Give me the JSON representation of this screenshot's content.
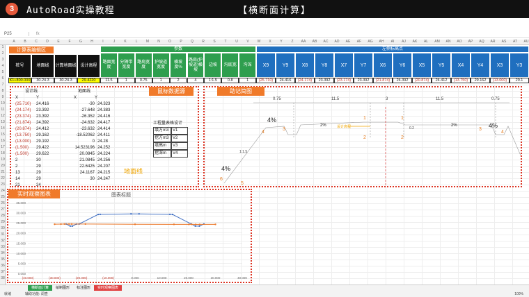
{
  "banner": {
    "number": "3",
    "title": "AutoRoad实操教程",
    "section": "【横断面计算】"
  },
  "formula_bar": {
    "cell_ref": "P25",
    "fx": "fx"
  },
  "column_letters": [
    "A",
    "B",
    "C",
    "D",
    "E",
    "F",
    "G",
    "H",
    "I",
    "J",
    "K",
    "L",
    "M",
    "N",
    "O",
    "P",
    "Q",
    "R",
    "S",
    "T",
    "U",
    "V",
    "W",
    "X",
    "Y",
    "Z",
    "AA",
    "AB",
    "AC",
    "AD",
    "AE",
    "AF",
    "AG",
    "AH",
    "AI",
    "AJ",
    "AK",
    "AL",
    "AM",
    "AN",
    "AO",
    "AP",
    "AQ",
    "AR",
    "AS",
    "AT",
    "AU"
  ],
  "row_numbers": [
    "1",
    "2",
    "3",
    "4",
    "5",
    "6",
    "7",
    "8",
    "9",
    "10",
    "11",
    "12",
    "13",
    "14",
    "15",
    "16",
    "17",
    "18",
    "19",
    "20",
    "21",
    "22",
    "23",
    "24",
    "25",
    "26",
    "27",
    "28",
    "29",
    "30",
    "31",
    "32",
    "33",
    "34",
    "35",
    "36",
    "37",
    "38"
  ],
  "header": {
    "calc_area": "计算表编辑区",
    "params": "参数",
    "left_points": "左侧标高点",
    "cols_dark": [
      "桩号",
      "地面线",
      "计算地面线",
      "设计高程"
    ],
    "cols_green": [
      "路面宽度",
      "分隔带宽度",
      "路肩宽度",
      "护坡道宽度",
      "横坡度%",
      "路肩(护坡道)横坡",
      "边坡",
      "沟底宽",
      "沟深"
    ],
    "cols_blue": [
      "X9",
      "Y9",
      "X8",
      "Y8",
      "X7",
      "Y7",
      "X6",
      "Y6",
      "X5",
      "Y5",
      "X4",
      "Y4",
      "X3",
      "Y3"
    ]
  },
  "row3": [
    "K1+800.000",
    "30.24.3",
    "30.24.3",
    "29.4220",
    "11.5",
    "1",
    "0.75",
    "1",
    "2",
    "4",
    "1:1.5",
    "0.8",
    "1",
    "(25.710)",
    "24.416",
    "(24.174)",
    "23.392",
    "(23.174)",
    "23.392",
    "(21.874)",
    "24.392",
    "(20.874)",
    "24.412",
    "(13.750)",
    "29.162",
    "(13.000)",
    "29.1"
  ],
  "panels": {
    "data_src": "鼠标数据源",
    "drawing": "助记简图",
    "chart": "实时观察图表",
    "ground_line": "地面线"
  },
  "design_table": {
    "h1": "设计线",
    "h2": "地面线",
    "cols": [
      "X",
      "Y",
      "X",
      "Y"
    ],
    "rows": [
      [
        "(25.710)",
        "24.416",
        "-30",
        "24.323"
      ],
      [
        "(24.174)",
        "23.392",
        "-27.648",
        "24.383"
      ],
      [
        "(23.374)",
        "23.392",
        "-26.352",
        "24.416"
      ],
      [
        "(21.874)",
        "24.392",
        "-24.632",
        "24.417"
      ],
      [
        "(20.874)",
        "24.412",
        "-23.632",
        "24.414"
      ],
      [
        "(13.750)",
        "29.162",
        "-18.52062",
        "24.411"
      ],
      [
        "(13.000)",
        "29.192",
        "0",
        "24.28"
      ],
      [
        "(1.500)",
        "29.422",
        "14.523196",
        "24.252"
      ],
      [
        "(1.500)",
        "29.622",
        "20.0845",
        "24.224"
      ],
      [
        "2",
        "30",
        "21.0845",
        "24.256"
      ],
      [
        "2",
        "29",
        "22.6425",
        "24.207"
      ],
      [
        "13",
        "29",
        "24.1167",
        "24.215"
      ],
      [
        "14",
        "29",
        "30",
        "24.247"
      ],
      [
        "21",
        "24",
        "",
        ""
      ]
    ]
  },
  "quantity": {
    "title": "工程量表格设计",
    "rows": [
      [
        "填方m3",
        "V1"
      ],
      [
        "挖方m3",
        "V2"
      ],
      [
        "填高m",
        "V3"
      ],
      [
        "挖深m",
        "V4"
      ]
    ]
  },
  "drawing_labels": {
    "dims": [
      "0.75",
      "11.5",
      "3",
      "11.5",
      "0.75"
    ],
    "slopes": [
      "4%",
      "2%",
      "2%",
      "4%",
      "4%"
    ],
    "small": [
      "0.2",
      "1:1.5",
      "设计高程"
    ],
    "points": [
      "1",
      "2",
      "1",
      "2",
      "3",
      "4",
      "3",
      "4",
      "5",
      "6"
    ]
  },
  "chart_data": {
    "type": "line",
    "title": "图表标题",
    "xlim": [
      -40,
      40
    ],
    "ylim": [
      0,
      35
    ],
    "x_ticks": [
      "(40.000)",
      "(30.000)",
      "(20.000)",
      "(10.000)",
      "0.000",
      "10.000",
      "20.000",
      "30.000",
      "40.000"
    ],
    "y_ticks": [
      "0.000",
      "5.000",
      "10.000",
      "15.000",
      "20.000",
      "25.000",
      "30.000",
      "35.000"
    ],
    "series": [
      {
        "color": "#4472c4",
        "x": [
          -25.71,
          -24.174,
          -23.374,
          -21.874,
          -20.874,
          -13.75,
          -13.0,
          -1.5,
          1.5,
          13,
          14,
          21,
          22.5,
          24,
          25.7
        ],
        "y": [
          24.416,
          23.392,
          23.392,
          24.392,
          24.412,
          29.162,
          29.192,
          29.422,
          29.422,
          29.192,
          29.162,
          24.412,
          23.392,
          23.392,
          24.416
        ]
      },
      {
        "color": "#ed7d31",
        "x": [
          -30,
          -27.648,
          -26.352,
          -24.632,
          -23.632,
          -18.52,
          0,
          14.52,
          20.08,
          21.08,
          22.64,
          24.12,
          30
        ],
        "y": [
          24.323,
          24.383,
          24.416,
          24.417,
          24.414,
          24.411,
          24.28,
          24.252,
          24.224,
          24.256,
          24.207,
          24.215,
          24.247
        ]
      }
    ]
  },
  "sheet_tabs": [
    "横断面计算",
    "绘制图形",
    "标注图形",
    "实时观察图表"
  ],
  "status": {
    "left": "就绪",
    "mid": "辅助功能: 调查",
    "zoom": "100%"
  }
}
